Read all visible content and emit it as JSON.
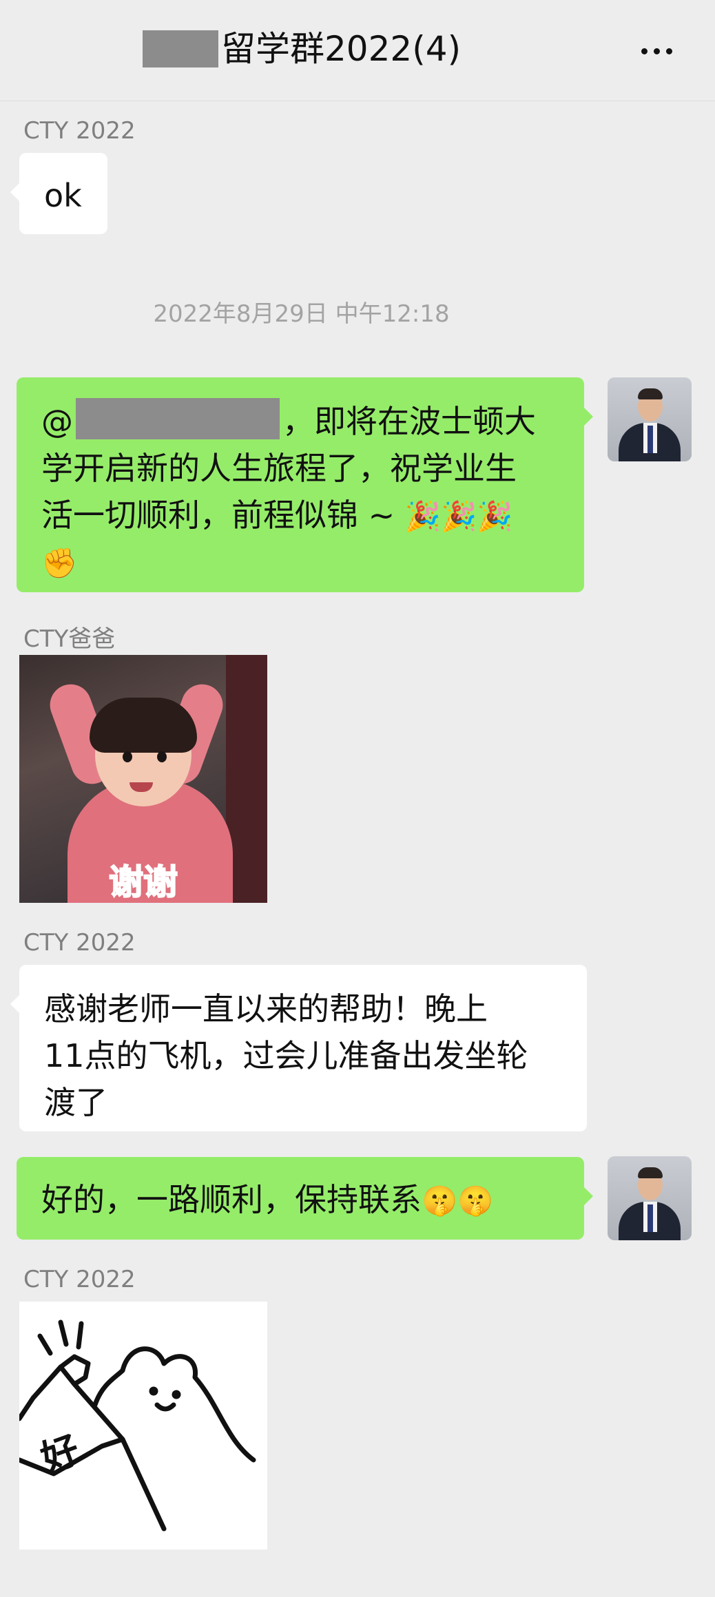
{
  "header": {
    "title": "留学群2022(4)",
    "more_icon": "more-dots-icon"
  },
  "messages": {
    "m1": {
      "sender": "CTY 2022",
      "text": "ok"
    },
    "timestamp": "2022年8月29日 中午12:18",
    "m2": {
      "line1_prefix": "@",
      "line1_suffix": "，即将在波士顿大",
      "line2": "学开启新的人生旅程了，祝学业生",
      "line3": "活一切顺利，前程似锦 ~ ",
      "emoji_party": "🎉🎉🎉",
      "emoji_fist": "✊"
    },
    "m3": {
      "sender": "CTY爸爸",
      "sticker_text": "谢谢"
    },
    "m4": {
      "sender": "CTY 2022",
      "line1": "感谢老师一直以来的帮助！晚上",
      "line2": "11点的飞机，过会儿准备出发坐轮",
      "line3": "渡了"
    },
    "m5": {
      "text": "好的，一路顺利，保持联系",
      "emoji": "🤫🤫"
    },
    "m6": {
      "sender": "CTY 2022",
      "sticker_text": "好"
    }
  },
  "colors": {
    "background": "#ededed",
    "bubble_self": "#95ec69",
    "bubble_other": "#ffffff"
  }
}
